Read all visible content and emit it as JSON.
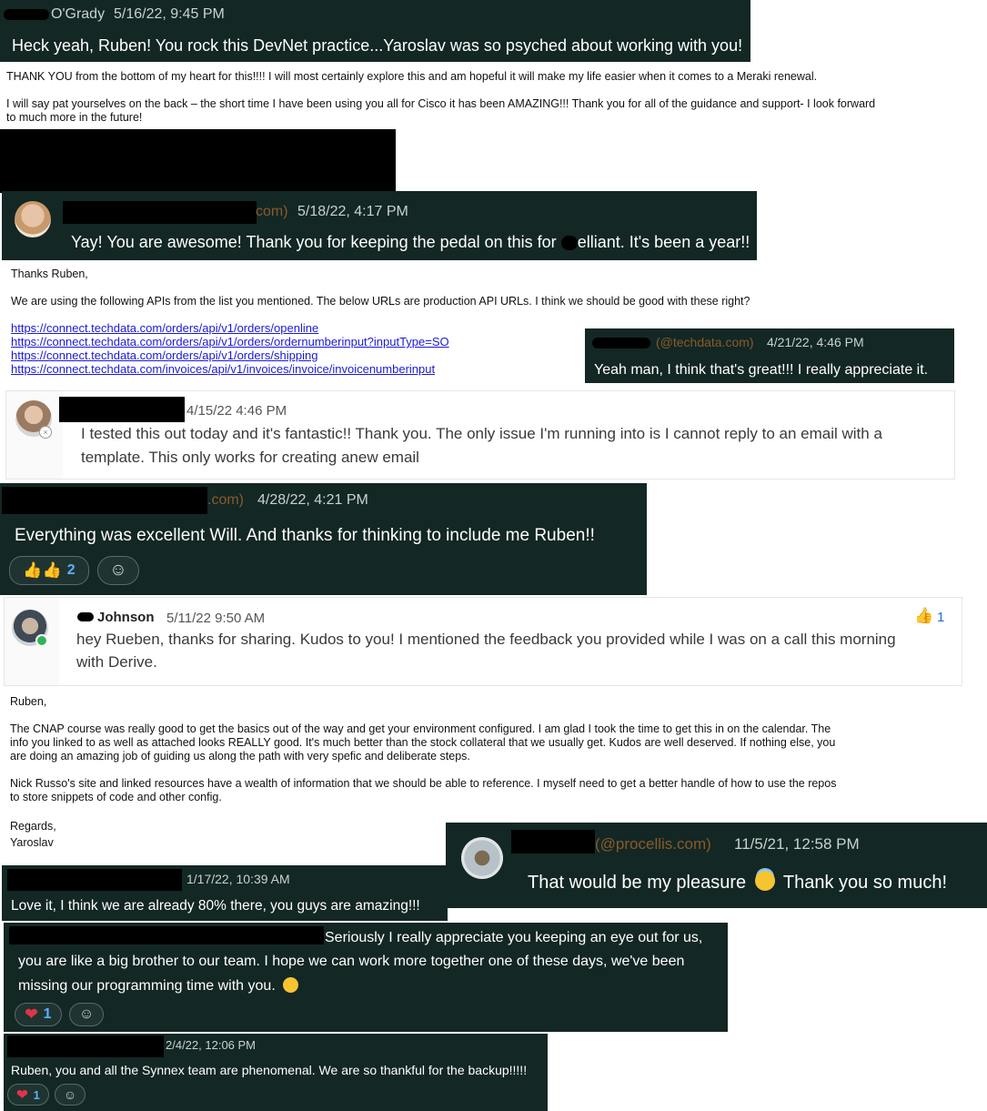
{
  "chat1": {
    "name": "O'Grady",
    "timestamp": "5/16/22, 9:45 PM",
    "message": "Heck yeah, Ruben! You rock this DevNet practice...Yaroslav was so psyched about working with you!"
  },
  "email1": {
    "line1": "THANK YOU from the bottom of my heart for this!!!! I will most certainly explore this and am hopeful it will make my life easier when it comes to a Meraki renewal.",
    "line2a": "I will say pat yourselves on the back – the short time I have been using you all for Cisco it has been AMAZING!!!  Thank you for all of the guidance and support- I look forward",
    "line2b": "to much more in the future!"
  },
  "chat2": {
    "domain": "com)",
    "timestamp": "5/18/22, 4:17 PM",
    "message": "Yay! You are awesome! Thank you for keeping the pedal on this for ",
    "message_end": "elliant. It's been a year!!"
  },
  "email2": {
    "greeting": "Thanks Ruben,",
    "body": "We are using the following APIs from the list you mentioned. The below URLs are production API URLs. I think we should be good with these right?",
    "links": [
      "https://connect.techdata.com/orders/api/v1/orders/openline",
      "https://connect.techdata.com/orders/api/v1/orders/ordernumberinput?inputType=SO",
      "https://connect.techdata.com/orders/api/v1/orders/shipping",
      "https://connect.techdata.com/invoices/api/v1/invoices/invoice/invoicenumberinput"
    ]
  },
  "chat3": {
    "domain": "(@techdata.com)",
    "timestamp": "4/21/22, 4:46 PM",
    "message": "Yeah man, I think that's great!!!  I really appreciate it."
  },
  "chat4": {
    "timestamp": "4/15/22 4:46 PM",
    "line1": "I tested this out today and it's fantastic!! Thank you. The only issue I'm running into is I cannot reply to an email with a",
    "line2": "template. This only works for creating anew email"
  },
  "chat5": {
    "domain": ".com)",
    "timestamp": "4/28/22, 4:21 PM",
    "message": "Everything was excellent Will. And thanks for thinking to include me Ruben!!",
    "reaction_count": "2"
  },
  "chat6": {
    "name": "Johnson",
    "timestamp": "5/11/22 9:50 AM",
    "reaction_count": "1",
    "line1": "hey Rueben, thanks for sharing. Kudos to you! I mentioned the feedback you provided while I was on a call this morning",
    "line2": "with Derive."
  },
  "email3": {
    "greeting": "Ruben,",
    "p1": [
      "The CNAP course was really good to get the basics out of the way and get your environment configured. I am glad I took the time to get this in on the calendar. The",
      "info you linked to as well as attached looks REALLY good. It's much better than the stock collateral that we usually get. Kudos are well deserved. If nothing else, you",
      "are doing an amazing job of guiding us along the path with very spefic and deliberate steps."
    ],
    "p2": [
      "Nick Russo's site and linked resources have a wealth of information that we should be able to reference. I myself need to get a better handle of how to use the repos",
      "to store snippets of code and other config."
    ],
    "closing": "Regards,",
    "signature": "Yaroslav"
  },
  "chat7": {
    "domain": "(@procellis.com)",
    "timestamp": "11/5/21, 12:58 PM",
    "message_a": "That would be my pleasure",
    "message_b": "Thank you so much!"
  },
  "chat8": {
    "timestamp": "1/17/22, 10:39 AM",
    "message": "Love it, I think we are already 80% there, you guys are amazing!!!"
  },
  "chat9": {
    "line1": "Seriously I really appreciate you keeping an eye out for us,",
    "line2": "you are like a big brother to our team. I hope we can work more together one of these days, we've been",
    "line3": "missing our programming time with you.",
    "reaction_count": "1"
  },
  "chat10": {
    "timestamp": "2/4/22, 12:06 PM",
    "message": "Ruben, you and all the Synnex team are phenomenal. We are so thankful for the backup!!!!!",
    "reaction_count": "1"
  }
}
